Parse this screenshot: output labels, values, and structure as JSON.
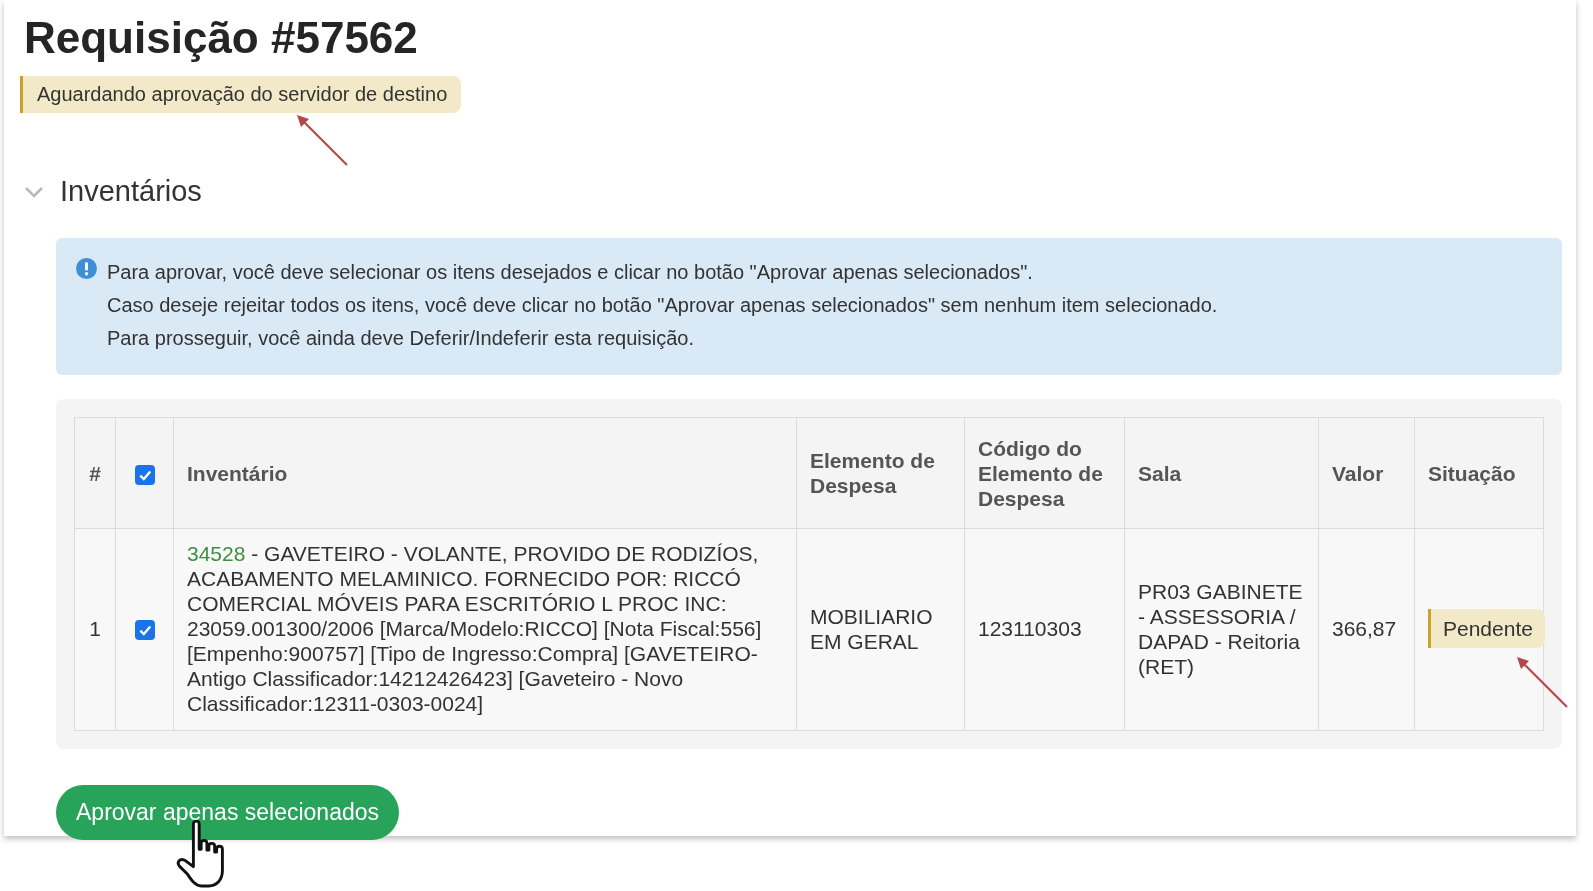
{
  "title": "Requisição #57562",
  "status_badge": "Aguardando aprovação do servidor de destino",
  "section": {
    "title": "Inventários",
    "expanded": true
  },
  "info": {
    "lines": [
      "Para aprovar, você deve selecionar os itens desejados e clicar no botão \"Aprovar apenas selecionados\".",
      "Caso deseje rejeitar todos os itens, você deve clicar no botão \"Aprovar apenas selecionados\" sem nenhum item selecionado.",
      "Para prosseguir, você ainda deve Deferir/Indeferir esta requisição."
    ]
  },
  "table": {
    "columns": [
      {
        "kind": "text",
        "label": "#"
      },
      {
        "kind": "checkbox",
        "checked": true
      },
      {
        "kind": "text",
        "label": "Inventário"
      },
      {
        "kind": "text",
        "label": "Elemento de Despesa"
      },
      {
        "kind": "text",
        "label": "Código do Elemento de Despesa"
      },
      {
        "kind": "text",
        "label": "Sala"
      },
      {
        "kind": "text",
        "label": "Valor"
      },
      {
        "kind": "text",
        "label": "Situação"
      }
    ],
    "rows": [
      {
        "number": "1",
        "selected": true,
        "code": "34528",
        "description": "- GAVETEIRO - VOLANTE, PROVIDO DE RODIZÍOS, ACABAMENTO MELAMINICO. FORNECIDO POR: RICCÓ COMERCIAL MÓVEIS PARA ESCRITÓRIO L PROC INC: 23059.001300/2006 [Marca/Modelo:RICCO] [Nota Fiscal:556] [Empenho:900757] [Tipo de Ingresso:Compra] [GAVETEIRO- Antigo Classificador:14212426423] [Gaveteiro - Novo Classificador:12311-0303-0024]",
        "elemento": "MOBILIARIO EM GERAL",
        "codigo": "123110303",
        "sala": "PR03 GABINETE - ASSESSORIA / DAPAD - Reitoria (RET)",
        "valor": "366,87",
        "situacao": "Pendente"
      }
    ]
  },
  "approve_button": "Aprovar apenas selecionados"
}
